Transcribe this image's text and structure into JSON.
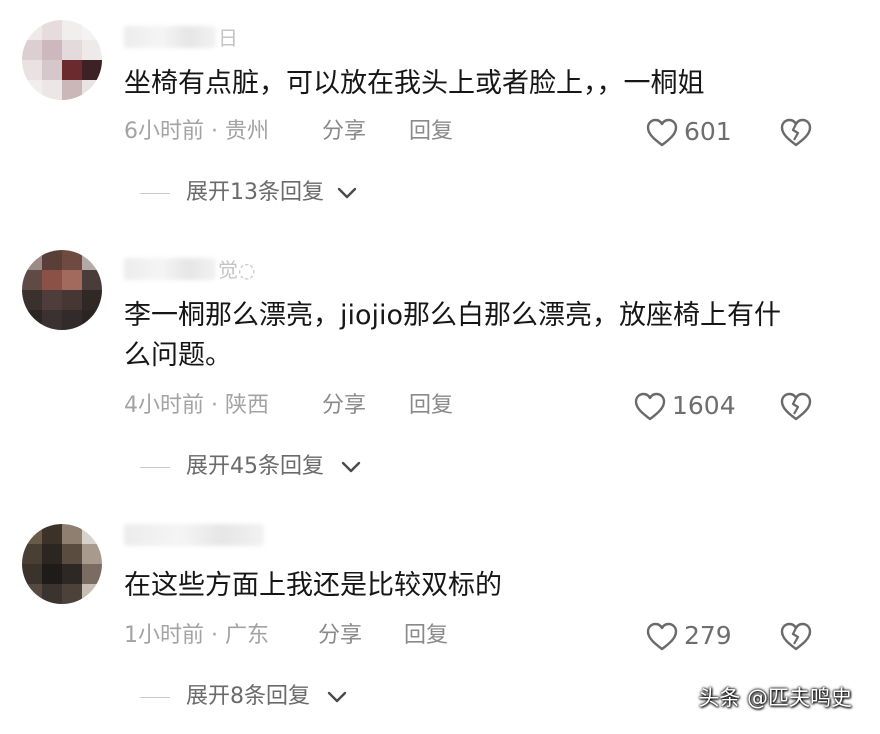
{
  "comments": [
    {
      "name_tail": "日",
      "text": "坐椅有点脏，可以放在我头上或者脸上，，一桐姐",
      "time": "6小时前",
      "dot": "·",
      "location": "贵州",
      "share": "分享",
      "reply": "回复",
      "likes": "601",
      "expand": "展开13条回复"
    },
    {
      "name_tail": "觉◌",
      "text_line1": "李一桐那么漂亮，jiojio那么白那么漂亮，放座椅上有什",
      "text_line2": "么问题。",
      "time": "4小时前",
      "dot": "·",
      "location": "陕西",
      "share": "分享",
      "reply": "回复",
      "likes": "1604",
      "expand": "展开45条回复"
    },
    {
      "name_tail": "",
      "text": "在这些方面上我还是比较双标的",
      "time": "1小时前",
      "dot": "·",
      "location": "广东",
      "share": "分享",
      "reply": "回复",
      "likes": "279",
      "expand": "展开8条回复"
    }
  ],
  "watermark": "头条 @匹夫鸣史",
  "icons": {
    "like": "heart-outline-icon",
    "dislike": "broken-heart-icon",
    "expand": "chevron-down-icon"
  },
  "colors": {
    "text_primary": "#161616",
    "text_meta": "#a3a3a3",
    "text_action": "#8a8a8a"
  }
}
